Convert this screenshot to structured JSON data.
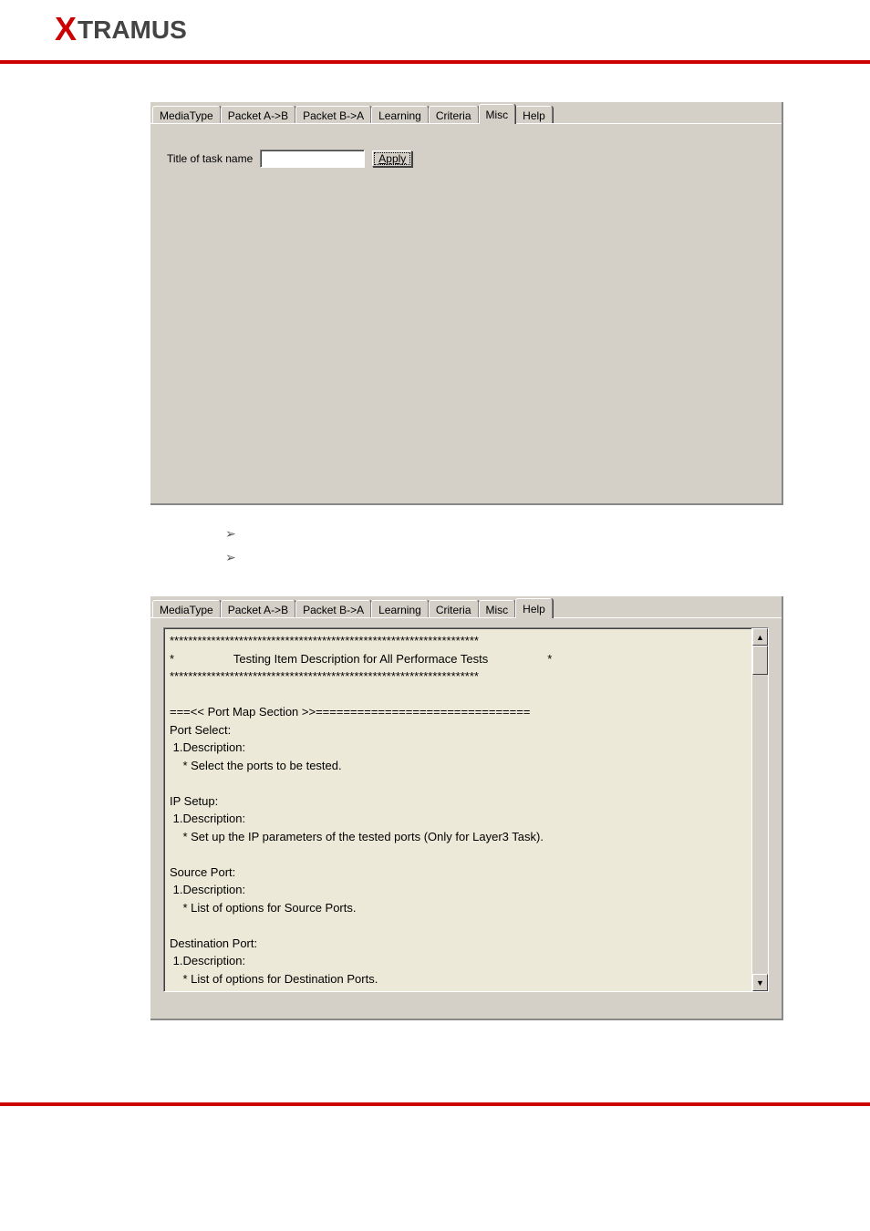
{
  "logo": {
    "x": "X",
    "rest": "TRAMUS"
  },
  "tabs": [
    "MediaType",
    "Packet A->B",
    "Packet B->A",
    "Learning",
    "Criteria",
    "Misc",
    "Help"
  ],
  "panel1": {
    "activeTab": "Misc",
    "titleLabel": "Title of task name",
    "applyLabel": "Apply",
    "titleValue": ""
  },
  "panel2": {
    "activeTab": "Help",
    "helpText": "*******************************************************************\n*                  Testing Item Description for All Performace Tests                  *\n*******************************************************************\n\n===<< Port Map Section >>===============================\nPort Select:\n 1.Description:\n    * Select the ports to be tested.\n\nIP Setup:\n 1.Description:\n    * Set up the IP parameters of the tested ports (Only for Layer3 Task).\n\nSource Port:\n 1.Description:\n    * List of options for Source Ports.\n\nDestination Port:\n 1.Description:\n    * List of options for Destination Ports."
  }
}
